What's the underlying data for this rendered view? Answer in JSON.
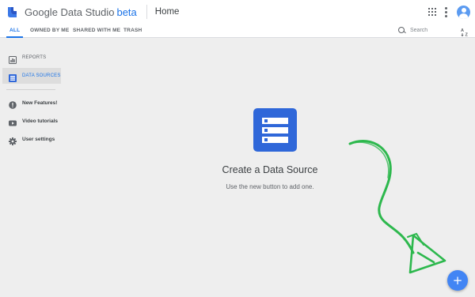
{
  "app": {
    "brand_name": "Google Data Studio",
    "brand_tag": "beta",
    "page_title": "Home"
  },
  "header": {
    "icons": [
      "apps-grid-icon",
      "more-vert-icon",
      "account-avatar-icon"
    ]
  },
  "tabs": [
    {
      "label": "ALL",
      "active": true
    },
    {
      "label": "OWNED BY ME",
      "active": false
    },
    {
      "label": "SHARED WITH ME",
      "active": false
    },
    {
      "label": "TRASH",
      "active": false
    }
  ],
  "search": {
    "placeholder": "Search",
    "value": ""
  },
  "sidebar": {
    "primary": [
      {
        "label": "REPORTS",
        "icon": "reports-icon",
        "active": false
      },
      {
        "label": "DATA SOURCES",
        "icon": "data-sources-icon",
        "active": true
      }
    ],
    "secondary": [
      {
        "label": "New Features!",
        "icon": "new-features-icon"
      },
      {
        "label": "Video tutorials",
        "icon": "video-icon"
      },
      {
        "label": "User settings",
        "icon": "settings-gear-icon"
      }
    ]
  },
  "empty_state": {
    "title": "Create a Data Source",
    "subtitle": "Use the new button to add one.",
    "icon": "data-source-list-icon"
  },
  "fab": {
    "label": "+",
    "icon": "add-icon"
  },
  "colors": {
    "accent": "#1a73e8",
    "icon_blue": "#2f67d9",
    "fab": "#4285f4",
    "annotation_green": "#2db84d",
    "background": "#eeeeee"
  }
}
